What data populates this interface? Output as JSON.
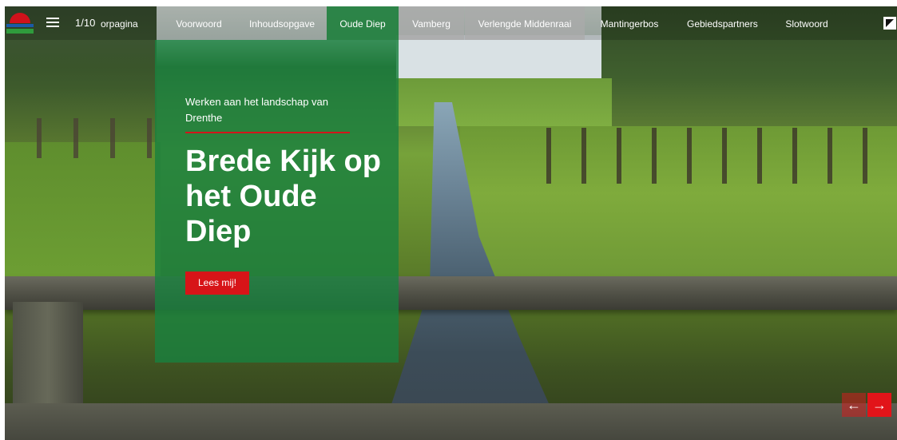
{
  "header": {
    "counter": "1/10",
    "nav": [
      {
        "label": "orpagina"
      },
      {
        "label": "Voorwoord"
      },
      {
        "label": "Inhoudsopgave"
      },
      {
        "label": "Oude Diep"
      },
      {
        "label": "Vamberg"
      },
      {
        "label": "Verlengde Middenraai"
      },
      {
        "label": "Mantingerbos"
      },
      {
        "label": "Gebiedspartners"
      },
      {
        "label": "Slotwoord"
      }
    ],
    "active_index": 3,
    "icons": {
      "menu": "hamburger-icon",
      "fullscreen": "fullscreen-icon",
      "logo": "provincie-logo"
    }
  },
  "hero": {
    "subtitle": "Werken aan het landschap van Drenthe",
    "headline": "Brede Kijk op het Oude Diep",
    "cta_label": "Lees mij!"
  },
  "controls": {
    "prev_icon": "arrow-left-icon",
    "next_icon": "arrow-right-icon"
  },
  "colors": {
    "accent_green": "#1a803e",
    "accent_red": "#d71418",
    "nav_inactive": "#aaaaaa"
  }
}
